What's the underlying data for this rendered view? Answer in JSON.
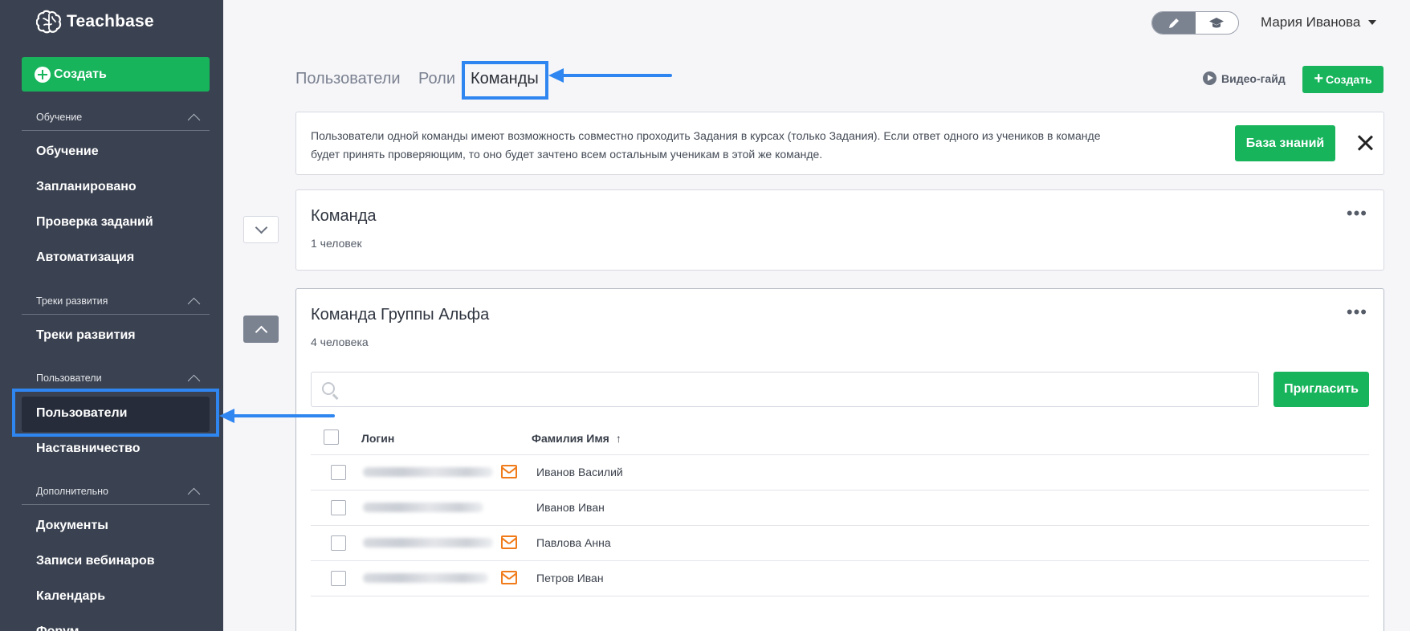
{
  "app": {
    "brand": "Teachbase"
  },
  "sidebar": {
    "create_label": "Создать",
    "sections": [
      {
        "title": "Обучение",
        "items": [
          "Обучение",
          "Запланировано",
          "Проверка заданий",
          "Автоматизация"
        ]
      },
      {
        "title": "Треки развития",
        "items": [
          "Треки развития"
        ]
      },
      {
        "title": "Пользователи",
        "items": [
          "Пользователи",
          "Наставничество"
        ]
      },
      {
        "title": "Дополнительно",
        "items": [
          "Документы",
          "Записи вебинаров",
          "Календарь",
          "Форум"
        ]
      }
    ],
    "active_item": "Пользователи"
  },
  "header": {
    "user_name": "Мария Иванова",
    "mode_toggle": {
      "options": [
        "edit-pencil-icon",
        "student-cap-icon"
      ],
      "active": "edit-pencil-icon"
    }
  },
  "tabs": [
    {
      "label": "Пользователи",
      "active": false
    },
    {
      "label": "Роли",
      "active": false
    },
    {
      "label": "Команды",
      "active": true
    }
  ],
  "toolbar": {
    "video_guide_label": "Видео-гайд",
    "create_label": "Создать"
  },
  "info": {
    "text": "Пользователи одной команды имеют возможность совместно проходить Задания в курсах (только Задания). Если ответ одного из учеников в команде будет принять проверяющим, то оно будет зачтено всем остальным ученикам в этой же команде.",
    "button_label": "База знаний"
  },
  "teams": [
    {
      "name": "Команда",
      "count": "1 человек",
      "expanded": false
    },
    {
      "name": "Команда Группы Альфа",
      "count": "4 человека",
      "expanded": true,
      "search_placeholder": "",
      "invite_label": "Пригласить",
      "columns": {
        "login": "Логин",
        "fio": "Фамилия Имя",
        "sort": "↑"
      },
      "members": [
        {
          "name": "Иванов Василий",
          "has_mail": true
        },
        {
          "name": "Иванов Иван",
          "has_mail": false
        },
        {
          "name": "Павлова Анна",
          "has_mail": true
        },
        {
          "name": "Петров Иван",
          "has_mail": true
        }
      ]
    }
  ],
  "colors": {
    "sidebar": "#3a4150",
    "accent_green": "#17b45c",
    "highlight_blue": "#2f86f0",
    "mail_orange": "#f07b1a"
  }
}
